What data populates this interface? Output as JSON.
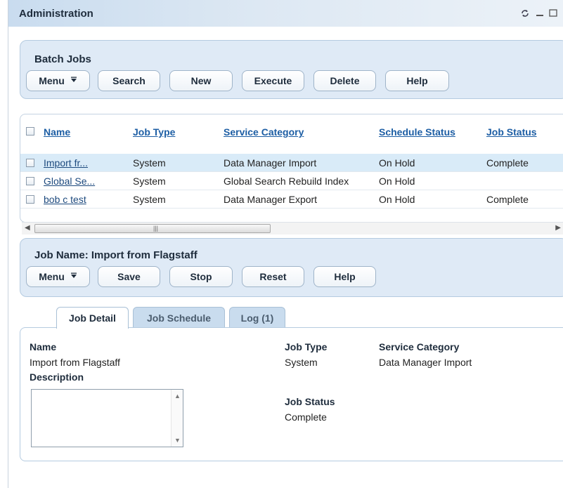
{
  "window": {
    "title": "Administration"
  },
  "batch_jobs": {
    "title": "Batch Jobs",
    "buttons": {
      "menu": "Menu",
      "search": "Search",
      "new": "New",
      "execute": "Execute",
      "delete": "Delete",
      "help": "Help"
    }
  },
  "table": {
    "columns": [
      "Name",
      "Job Type",
      "Service Category",
      "Schedule Status",
      "Job Status"
    ],
    "rows": [
      {
        "name": "Import fr...",
        "job_type": "System",
        "service_category": "Data Manager Import",
        "schedule_status": "On Hold",
        "job_status": "Complete",
        "selected": true
      },
      {
        "name": "Global Se...",
        "job_type": "System",
        "service_category": "Global Search Rebuild Index",
        "schedule_status": "On Hold",
        "job_status": ""
      },
      {
        "name": "bob c test",
        "job_type": "System",
        "service_category": "Data Manager Export",
        "schedule_status": "On Hold",
        "job_status": "Complete"
      }
    ]
  },
  "job_panel": {
    "title": "Job Name: Import from Flagstaff",
    "buttons": {
      "menu": "Menu",
      "save": "Save",
      "stop": "Stop",
      "reset": "Reset",
      "help": "Help"
    }
  },
  "tabs": [
    {
      "label": "Job Detail",
      "active": true
    },
    {
      "label": "Job Schedule",
      "active": false
    },
    {
      "label": "Log (1)",
      "active": false
    }
  ],
  "detail": {
    "name_label": "Name",
    "name_value": "Import from Flagstaff",
    "description_label": "Description",
    "description_value": "",
    "job_type_label": "Job Type",
    "job_type_value": "System",
    "service_category_label": "Service Category",
    "service_category_value": "Data Manager Import",
    "job_status_label": "Job Status",
    "job_status_value": "Complete"
  },
  "icons": {
    "refresh": "refresh-icon",
    "minimize": "minimize-icon",
    "maximize": "maximize-icon",
    "menu_dropdown": "caret-down-icon",
    "scroll_grip": "grip-icon"
  },
  "colors": {
    "panel_bg": "#dfeaf6",
    "link": "#1d5ea4",
    "selected_row": "#d9ebf8"
  }
}
